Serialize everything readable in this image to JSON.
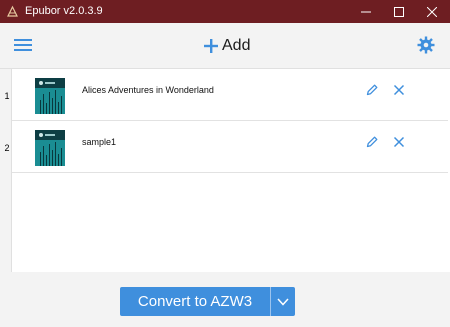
{
  "window": {
    "title": "Epubor v2.0.3.9",
    "accent_color": "#6e1e22"
  },
  "toolbar": {
    "add_label": "Add",
    "accent_color": "#3f8fdd"
  },
  "books": [
    {
      "index": "1",
      "title": "Alices Adventures in Wonderland"
    },
    {
      "index": "2",
      "title": "sample1"
    }
  ],
  "convert": {
    "label": "Convert to AZW3",
    "button_color": "#3f8fdd"
  }
}
